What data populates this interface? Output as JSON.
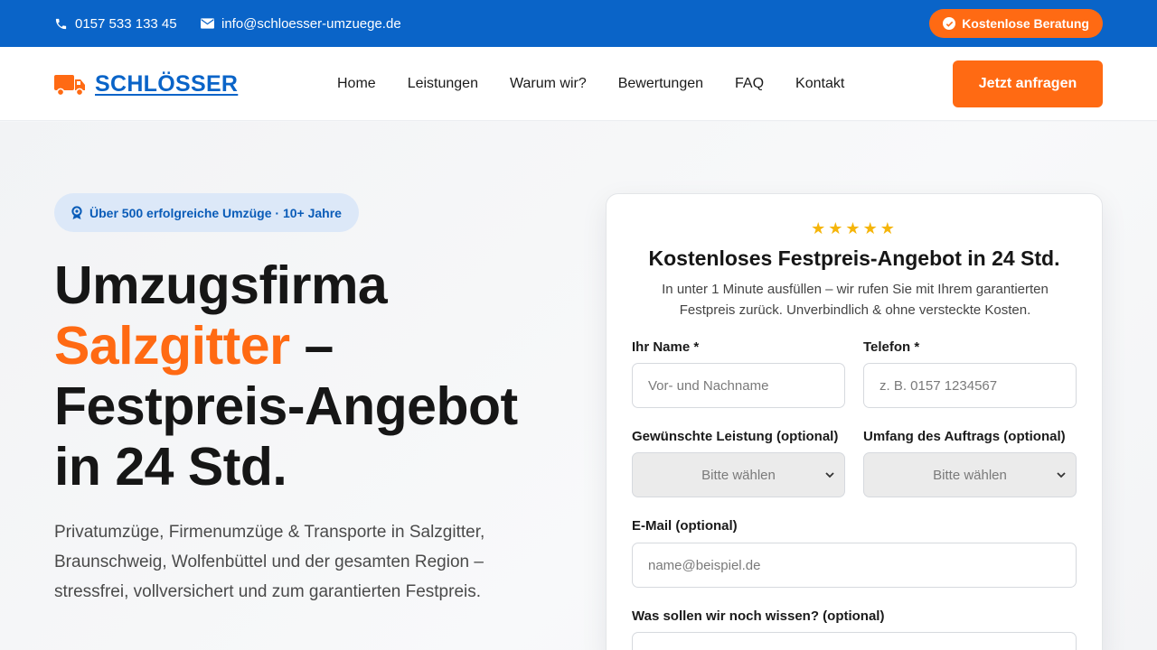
{
  "topbar": {
    "phone": "0157 533 133 45",
    "email": "info@schloesser-umzuege.de",
    "cta_label": "Kostenlose Beratung"
  },
  "header": {
    "brand": "SCHLÖSSER",
    "nav": [
      "Home",
      "Leistungen",
      "Warum wir?",
      "Bewertungen",
      "FAQ",
      "Kontakt"
    ],
    "cta_label": "Jetzt anfragen"
  },
  "hero": {
    "badge": "Über 500 erfolgreiche Umzüge · 10+ Jahre",
    "headline_line1": "Umzugsfirma",
    "headline_highlight": "Salzgitter",
    "headline_dash": " –",
    "headline_line3": "Festpreis-Angebot",
    "headline_line4": "in 24 Std.",
    "subline": "Privatumzüge, Firmenumzüge & Transporte in Salzgitter, Braunschweig, Wolfenbüttel und der gesamten Region – stressfrei, vollversichert und zum garantierten Festpreis."
  },
  "form": {
    "stars": "★★★★★",
    "title": "Kostenloses Festpreis-Angebot in 24 Std.",
    "subtitle": "In unter 1 Minute ausfüllen – wir rufen Sie mit Ihrem garantierten Festpreis zurück. Unverbindlich & ohne versteckte Kosten.",
    "name_label": "Ihr Name *",
    "name_placeholder": "Vor- und Nachname",
    "phone_label": "Telefon *",
    "phone_placeholder": "z. B. 0157 1234567",
    "service_label": "Gewünschte Leistung (optional)",
    "service_value": "Bitte wählen",
    "scope_label": "Umfang des Auftrags (optional)",
    "scope_value": "Bitte wählen",
    "email_label": "E-Mail (optional)",
    "email_placeholder": "name@beispiel.de",
    "notes_label": "Was sollen wir noch wissen? (optional)"
  },
  "colors": {
    "primary_blue": "#0a64c8",
    "accent_orange": "#ff6a13",
    "star_yellow": "#f5b50a"
  },
  "icons": [
    "phone-icon",
    "mail-icon",
    "check-circle-icon",
    "truck-icon",
    "award-icon",
    "chevron-down-icon"
  ]
}
